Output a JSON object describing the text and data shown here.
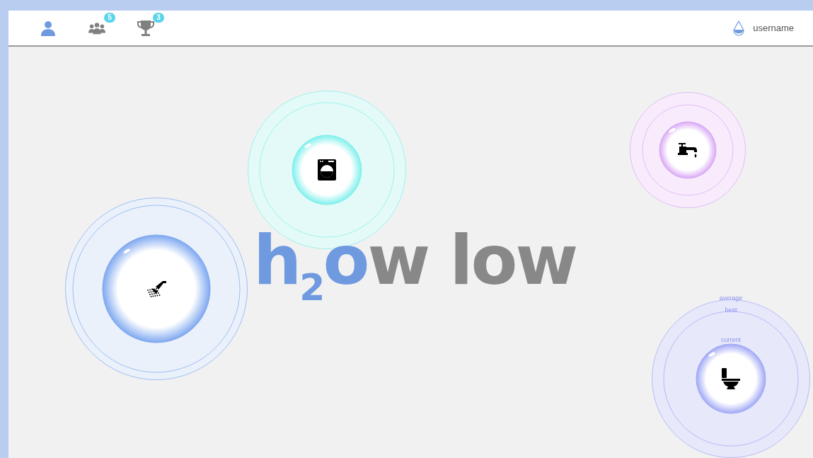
{
  "nav": [
    {
      "kind": "user",
      "selected": true
    },
    {
      "kind": "group",
      "selected": false,
      "badge": "5"
    },
    {
      "kind": "trophy",
      "selected": false,
      "badge": "3"
    }
  ],
  "account": {
    "username": "username"
  },
  "logo": [
    {
      "text": "h",
      "kind": "normal",
      "color": "#6f9ae0"
    },
    {
      "text": "2",
      "kind": "subscript",
      "color": "#6f9ae0"
    },
    {
      "text": "o",
      "kind": "normal",
      "color": "#6f9ae0"
    },
    {
      "text": "w low",
      "kind": "normal",
      "color": "#888888"
    }
  ],
  "bubbles": [
    {
      "kind": "shower",
      "color": "#7fa8f0"
    },
    {
      "kind": "washer",
      "color": "#7ff0ec"
    },
    {
      "kind": "tap",
      "color": "#d9a8f5"
    },
    {
      "kind": "toilet",
      "color": "#a0a8f5",
      "labels": [
        "average",
        "best",
        "current"
      ]
    }
  ]
}
